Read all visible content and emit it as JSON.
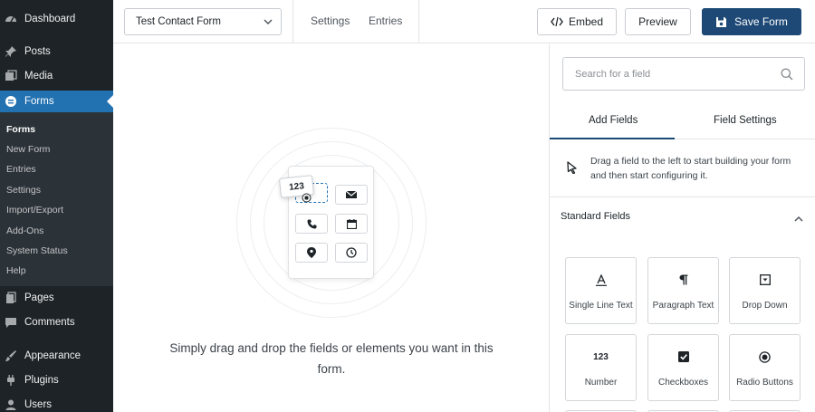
{
  "wp_menu": {
    "dashboard": "Dashboard",
    "posts": "Posts",
    "media": "Media",
    "forms": "Forms",
    "pages": "Pages",
    "comments": "Comments",
    "appearance": "Appearance",
    "plugins": "Plugins",
    "users": "Users"
  },
  "forms_submenu": [
    "Forms",
    "New Form",
    "Entries",
    "Settings",
    "Import/Export",
    "Add-Ons",
    "System Status",
    "Help"
  ],
  "topbar": {
    "form_name": "Test Contact Form",
    "settings_link": "Settings",
    "entries_link": "Entries",
    "embed_label": "Embed",
    "preview_label": "Preview",
    "save_label": "Save Form"
  },
  "canvas": {
    "drag_chip_label": "123",
    "empty_message": "Simply drag and drop the fields or elements you want in this form."
  },
  "panel": {
    "search_placeholder": "Search for a field",
    "tabs": [
      "Add Fields",
      "Field Settings"
    ],
    "hint": "Drag a field to the left to start building your form and then start configuring it.",
    "section_title": "Standard Fields",
    "fields": [
      {
        "label": "Single Line Text",
        "icon": "single-line-text-icon"
      },
      {
        "label": "Paragraph Text",
        "icon": "paragraph-icon"
      },
      {
        "label": "Drop Down",
        "icon": "dropdown-icon"
      },
      {
        "label": "Number",
        "icon": "number-icon",
        "glyph": "123"
      },
      {
        "label": "Checkboxes",
        "icon": "checkbox-icon"
      },
      {
        "label": "Radio Buttons",
        "icon": "radio-icon"
      }
    ]
  },
  "colors": {
    "sidebar_bg": "#1d2327",
    "sidebar_active": "#2271b1",
    "save_button": "#1e4976"
  }
}
